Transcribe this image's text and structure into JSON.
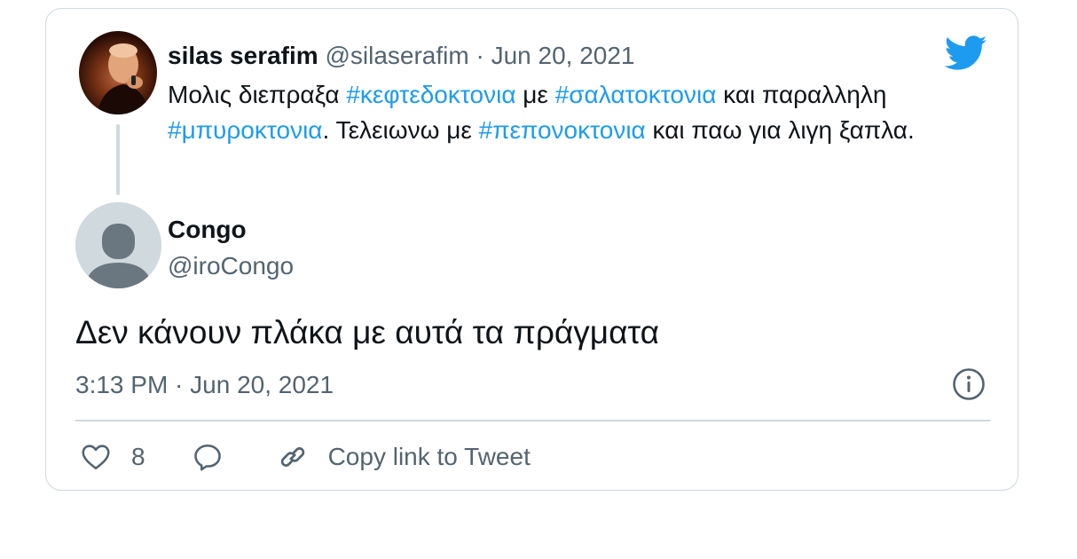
{
  "colors": {
    "link": "#1d9bf0",
    "secondary_text": "#536471",
    "primary_text": "#0f1419",
    "border": "#cfd9de"
  },
  "quoted_tweet": {
    "author_name": "silas serafim",
    "author_handle": "@silaserafim",
    "separator": " · ",
    "date": "Jun 20, 2021",
    "text_parts": {
      "p1": "Μολις διεπραξα ",
      "h1": "#κεφτεδοκτονια",
      "p2": " με ",
      "h2": "#σαλατοκτονια",
      "p3": " και παραλληλη ",
      "h3": "#μπυροκτονια",
      "p4": ". Τελειωνω με ",
      "h4": "#πεπονοκτονια",
      "p5": " και παω για λιγη ξαπλα."
    },
    "logo_icon": "twitter-bird-icon"
  },
  "reply_tweet": {
    "author_name": "Congo",
    "author_handle": "@iroCongo",
    "text": "Δεν κάνουν πλάκα με αυτά τα πράγματα",
    "timestamp": "3:13 PM · Jun 20, 2021",
    "avatar_icon": "default-avatar-icon"
  },
  "actions": {
    "like_count": "8",
    "copy_link_label": "Copy link to Tweet",
    "icons": [
      "heart-icon",
      "reply-icon",
      "link-icon",
      "info-icon"
    ]
  }
}
